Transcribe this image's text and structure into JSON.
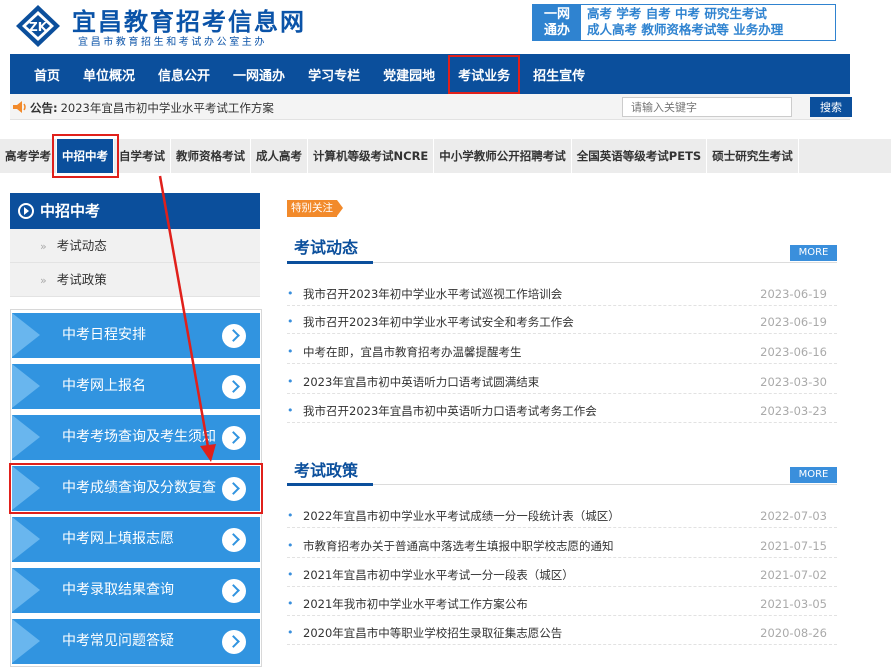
{
  "header": {
    "logo_text": "ZK",
    "title": "宜昌教育招考信息网",
    "subtitle": "宜昌市教育招生和考试办公室主办",
    "onestop_label_line1": "一网",
    "onestop_label_line2": "通办",
    "onestop_links_line1": "高考 学考 自考 中考 研究生考试",
    "onestop_links_line2": "成人高考 教师资格考试等 业务办理"
  },
  "mainnav": {
    "items": [
      "首页",
      "单位概况",
      "信息公开",
      "一网通办",
      "学习专栏",
      "党建园地",
      "考试业务",
      "招生宣传"
    ]
  },
  "notice": {
    "label": "公告:",
    "text": "2023年宜昌市初中学业水平考试工作方案",
    "search_placeholder": "请输入关键字",
    "search_button": "搜索"
  },
  "categories": [
    "高考学考",
    "中招中考",
    "自学考试",
    "教师资格考试",
    "成人高考",
    "计算机等级考试NCRE",
    "中小学教师公开招聘考试",
    "全国英语等级考试PETS",
    "硕士研究生考试"
  ],
  "sidebar": {
    "heading": "中招中考",
    "sub_items": [
      "考试动态",
      "考试政策"
    ],
    "buttons": [
      "中考日程安排",
      "中考网上报名",
      "中考考场查询及考生须知",
      "中考成绩查询及分数复查",
      "中考网上填报志愿",
      "中考录取结果查询",
      "中考常见问题答疑"
    ]
  },
  "content": {
    "special_tag": "特别关注",
    "more_label": "MORE",
    "sections": [
      {
        "title": "考试动态",
        "items": [
          {
            "title": "我市召开2023年初中学业水平考试巡视工作培训会",
            "date": "2023-06-19"
          },
          {
            "title": "我市召开2023年初中学业水平考试安全和考务工作会",
            "date": "2023-06-19"
          },
          {
            "title": "中考在即，宜昌市教育招考办温馨提醒考生",
            "date": "2023-06-16"
          },
          {
            "title": "2023年宜昌市初中英语听力口语考试圆满结束",
            "date": "2023-03-30"
          },
          {
            "title": "我市召开2023年宜昌市初中英语听力口语考试考务工作会",
            "date": "2023-03-23"
          }
        ]
      },
      {
        "title": "考试政策",
        "items": [
          {
            "title": "2022年宜昌市初中学业水平考试成绩一分一段统计表（城区）",
            "date": "2022-07-03"
          },
          {
            "title": "市教育招考办关于普通高中落选考生填报中职学校志愿的通知",
            "date": "2021-07-15"
          },
          {
            "title": "2021年宜昌市初中学业水平考试一分一段表（城区）",
            "date": "2021-07-02"
          },
          {
            "title": "2021年我市初中学业水平考试工作方案公布",
            "date": "2021-03-05"
          },
          {
            "title": "2020年宜昌市中等职业学校招生录取征集志愿公告",
            "date": "2020-08-26"
          }
        ]
      }
    ]
  },
  "colors": {
    "brand_blue": "#0b4f9c",
    "button_blue": "#3194e0",
    "highlight_red": "#e0201b",
    "tag_orange": "#f28a2b"
  }
}
